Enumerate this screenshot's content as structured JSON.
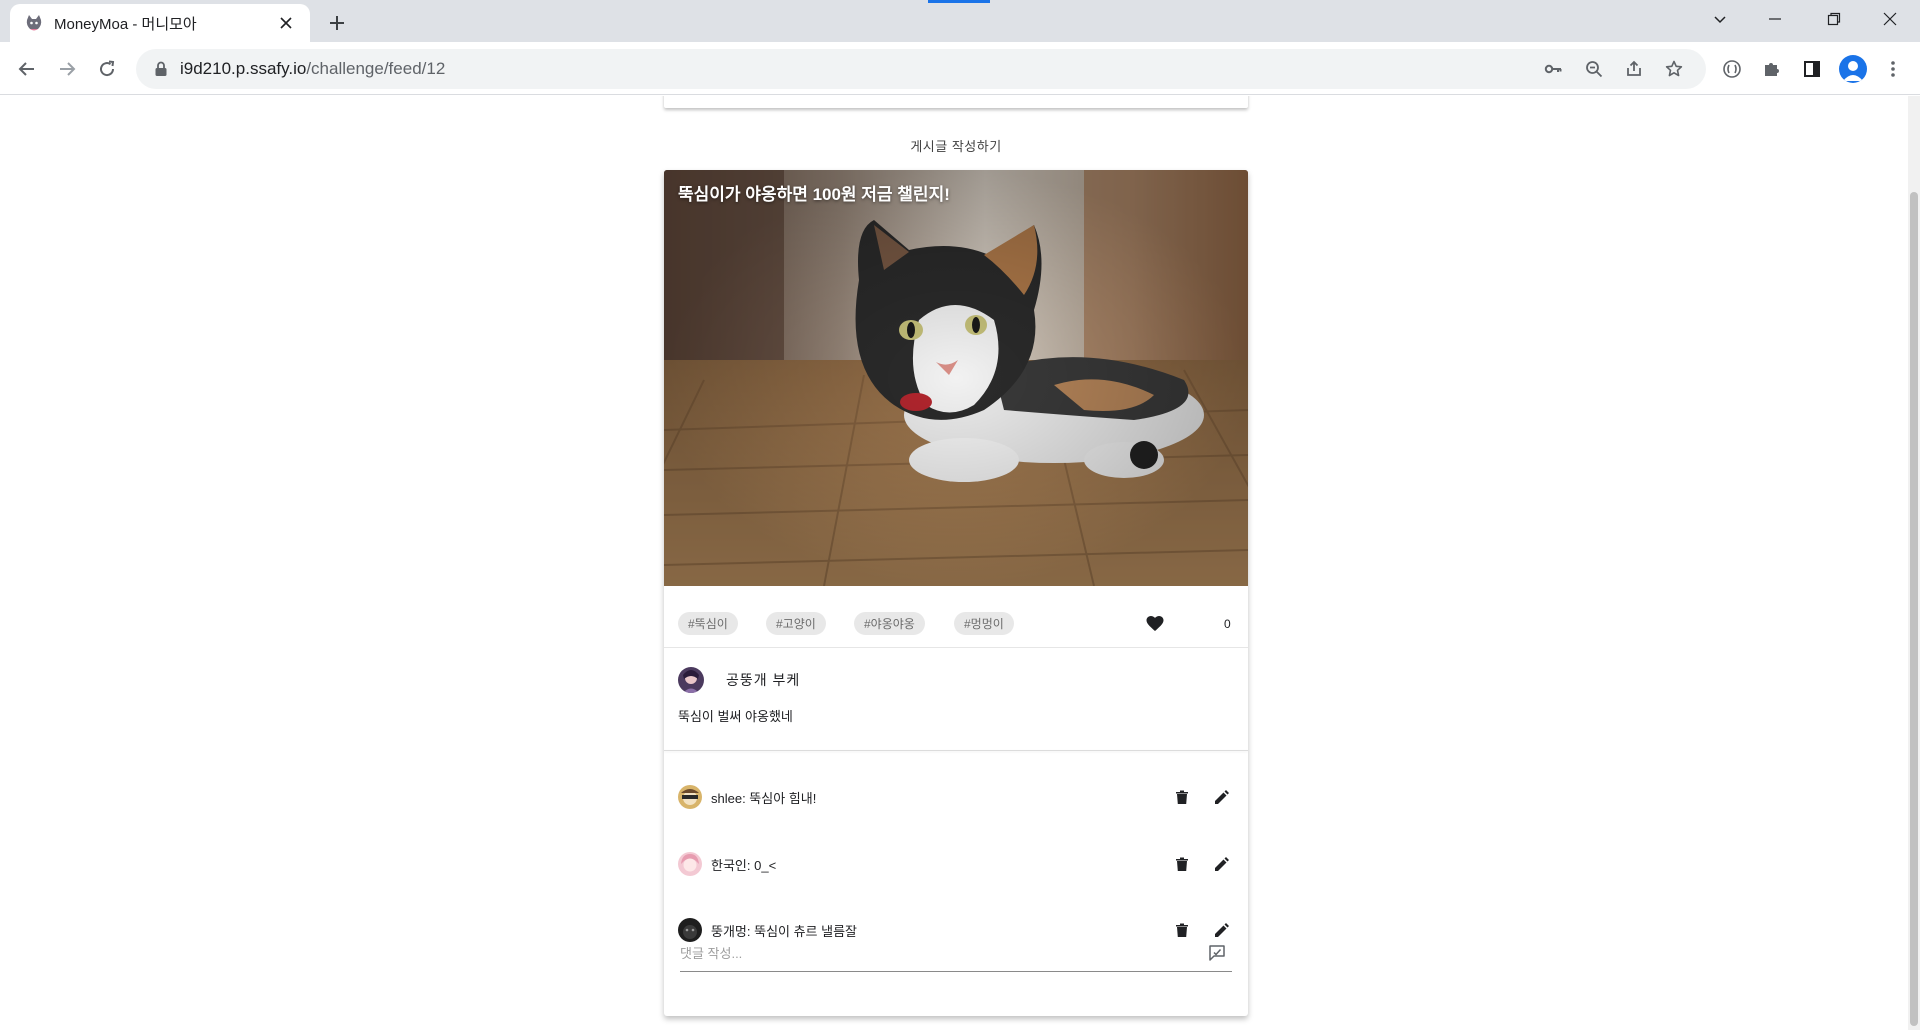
{
  "browser": {
    "tab_title": "MoneyMoa - 머니모아",
    "url_host": "i9d210.p.ssafy.io",
    "url_path": "/challenge/feed/12"
  },
  "page": {
    "write_post_label": "게시글 작성하기"
  },
  "post": {
    "title": "뚝심이가 야옹하면 100원 저금 챌린지!",
    "tags": [
      "#뚝심이",
      "#고양이",
      "#야옹야옹",
      "#멍멍이"
    ],
    "like_count": "0",
    "author": "공뚱개 부케",
    "body": "뚝심이 벌써 야옹했네",
    "comments": [
      {
        "text": "shlee: 뚝심아 힘내!"
      },
      {
        "text": "한국인: 0_<"
      },
      {
        "text": "뚱개멍: 뚝심이 츄르 낼름잘"
      }
    ],
    "comment_placeholder": "댓글 작성..."
  },
  "colors": {
    "accent": "#1a73e8",
    "chip_bg": "#e8e8e8",
    "chrome_bg": "#dee1e6"
  },
  "icons": [
    "cat-favicon-icon",
    "close-icon",
    "plus-icon",
    "chevron-down-icon",
    "minimize-icon",
    "restore-icon",
    "back-icon",
    "forward-icon",
    "reload-icon",
    "lock-icon",
    "key-icon",
    "zoom-out-icon",
    "share-icon",
    "star-icon",
    "extension-icon",
    "puzzle-icon",
    "sidebar-icon",
    "kebab-menu-icon",
    "heart-icon",
    "trash-icon",
    "pencil-icon",
    "comment-send-icon"
  ]
}
